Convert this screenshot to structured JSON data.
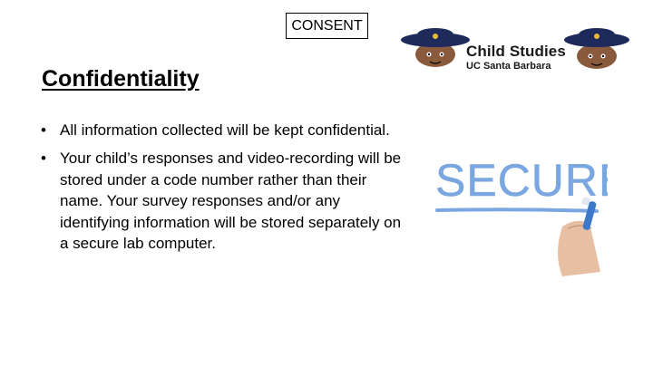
{
  "header": {
    "consent_label": "CONSENT"
  },
  "logo": {
    "line1": "Child Studies",
    "line2": "UC Santa Barbara"
  },
  "title": "Confidentiality",
  "bullets": [
    "All information collected will be kept confidential.",
    "Your child’s responses and video-recording will be stored under a code number rather than their name. Your survey responses and/or any identifying information will be stored separately on a secure lab computer."
  ],
  "image": {
    "word": "SECURE"
  },
  "colors": {
    "secure_blue": "#7aa7e0",
    "hat_navy": "#1f2a5c",
    "skin": "#8a5a3c"
  }
}
